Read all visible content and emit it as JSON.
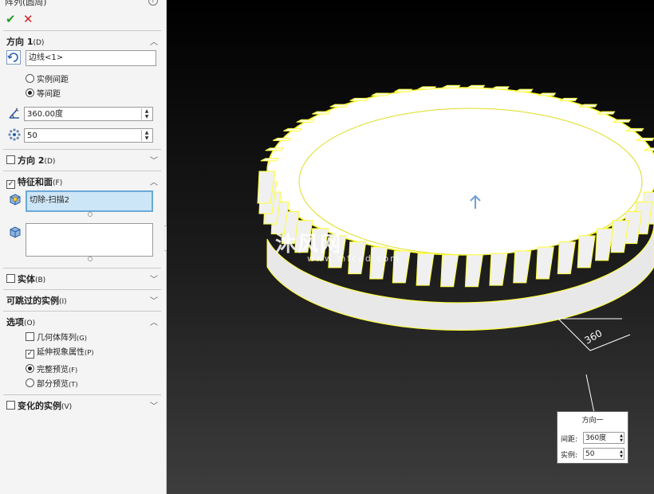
{
  "window": {
    "title": "阵列(圆周)",
    "help_icon": "help-icon"
  },
  "actions": {
    "ok": "✔",
    "cancel": "✕"
  },
  "direction1": {
    "label": "方向 1",
    "shortcut": "(D)",
    "edge_value": "边线<1>",
    "radio_instance_spacing": "实例间距",
    "radio_equal_spacing": "等间距",
    "angle_value": "360.00度",
    "count_value": "50"
  },
  "direction2": {
    "label": "方向 2",
    "shortcut": "(D)"
  },
  "features": {
    "label": "特征和面",
    "shortcut": "(F)",
    "list_item": "切除-扫描2"
  },
  "solid": {
    "label": "实体",
    "shortcut": "(B)"
  },
  "skip": {
    "label": "可跳过的实例",
    "shortcut": "(I)"
  },
  "options": {
    "label": "选项",
    "shortcut": "(O)",
    "geometry_pattern": "几何体阵列",
    "geometry_pattern_key": "(G)",
    "propagate_visual": "延伸视象属性",
    "propagate_visual_key": "(P)",
    "full_preview": "完整预览",
    "full_preview_key": "(F)",
    "partial_preview": "部分预览",
    "partial_preview_key": "(T)"
  },
  "vary": {
    "label": "变化的实例",
    "shortcut": "(V)"
  },
  "callout": {
    "title": "方向一",
    "spacing_label": "间距:",
    "spacing_value": "360度",
    "instances_label": "实例:",
    "instances_value": "50"
  },
  "viewport": {
    "dimension_label": "360",
    "watermark": "沐风网",
    "watermark_url": "www.mfcad.com"
  },
  "colors": {
    "accent_yellow": "#ffff33",
    "selection_blue": "#cde6f7",
    "ok_green": "#2a9a2a",
    "cancel_red": "#d02020"
  }
}
